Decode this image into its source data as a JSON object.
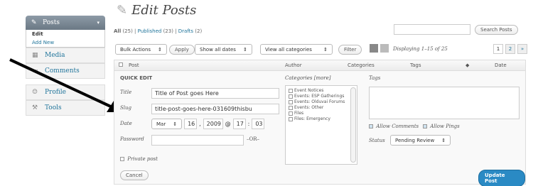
{
  "sidebar": {
    "posts_label": "Posts",
    "sub_items": [
      "Edit",
      "Add New"
    ],
    "items": [
      {
        "label": "Media",
        "icon": "media-icon"
      },
      {
        "label": "Comments",
        "icon": "comments-icon"
      }
    ],
    "items2": [
      {
        "label": "Profile",
        "icon": "profile-icon"
      },
      {
        "label": "Tools",
        "icon": "tools-icon"
      }
    ]
  },
  "page_title": "Edit Posts",
  "filters": {
    "all": "All",
    "all_count": "(25)",
    "published": "Published",
    "published_count": "(23)",
    "drafts": "Drafts",
    "drafts_count": "(2)"
  },
  "search": {
    "value": "",
    "button": "Search Posts"
  },
  "toolbar": {
    "bulk_actions": "Bulk Actions",
    "apply": "Apply",
    "dates": "Show all dates",
    "categories": "View all categories",
    "filter": "Filter",
    "displaying": "Displaying 1–15 of 25",
    "pages": [
      "1",
      "2",
      "»"
    ]
  },
  "table": {
    "columns": [
      "Post",
      "Author",
      "Categories",
      "Tags",
      "Date"
    ]
  },
  "quick_edit": {
    "heading": "QUICK EDIT",
    "title_label": "Title",
    "title_value": "Title of Post goes Here",
    "slug_label": "Slug",
    "slug_value": "title-post-goes-here-031609thisbu",
    "date_label": "Date",
    "month": "Mar",
    "day": "16",
    "year": "2009",
    "at": "@",
    "hour": "17",
    "minute": "03",
    "password_label": "Password",
    "or": "–OR–",
    "private_label": "Private post",
    "categories_label": "Categories [more]",
    "categories": [
      "Event Notices",
      "Events: ESP Gatherings",
      "Events: Olduvai Forums",
      "Events: Other",
      "Files",
      "Files: Emergency"
    ],
    "tags_label": "Tags",
    "allow_comments": "Allow Comments",
    "allow_pings": "Allow Pings",
    "status_label": "Status",
    "status_value": "Pending Review",
    "cancel": "Cancel",
    "update": "Update Post"
  },
  "colors": {
    "accent": "#21759b",
    "update_button": "#2a8ac4"
  }
}
